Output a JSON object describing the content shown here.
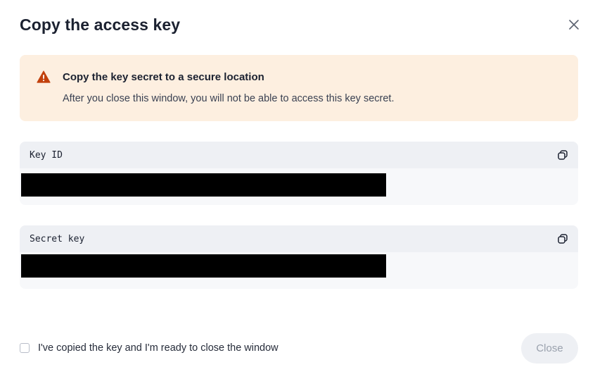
{
  "dialog": {
    "title": "Copy the access key",
    "close_icon": "close-icon"
  },
  "warning": {
    "icon": "warning-icon",
    "icon_color": "#c2410c",
    "background": "#fdefe0",
    "title": "Copy the key secret to a secure location",
    "text": "After you close this window, you will not be able to access this key secret."
  },
  "fields": [
    {
      "label": "Key ID",
      "copy_icon": "copy-icon",
      "value_redacted": true
    },
    {
      "label": "Secret key",
      "copy_icon": "copy-icon",
      "value_redacted": true
    }
  ],
  "footer": {
    "checkbox_label": "I've copied the key and I'm ready to close the window",
    "checkbox_checked": false,
    "close_button_label": "Close",
    "close_button_disabled": true
  }
}
